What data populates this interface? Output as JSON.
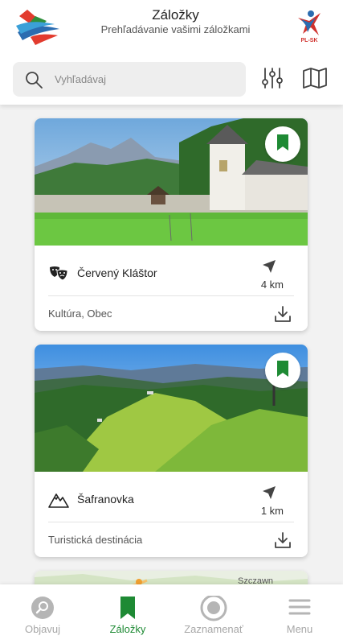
{
  "header": {
    "title": "Záložky",
    "subtitle": "Prehľadávanie vašimi záložkami",
    "partner_logo_text": "PL-SK"
  },
  "search": {
    "placeholder": "Vyhľadávaj",
    "value": ""
  },
  "toolbar": {
    "filter_icon": "sliders-icon",
    "map_icon": "map-icon"
  },
  "cards": [
    {
      "name": "Červený Kláštor",
      "category_icon": "theater-masks-icon",
      "distance": "4 km",
      "tags": "Kultúra, Obec",
      "bookmarked": true
    },
    {
      "name": "Šafranovka",
      "category_icon": "mountain-icon",
      "distance": "1 km",
      "tags": "Turistická destinácia",
      "bookmarked": true
    },
    {
      "map_label": "Szczawn"
    }
  ],
  "tabbar": {
    "tabs": [
      {
        "label": "Objavuj",
        "icon": "search-magnifier-icon",
        "active": false
      },
      {
        "label": "Záložky",
        "icon": "bookmark-icon",
        "active": true
      },
      {
        "label": "Zaznamenať",
        "icon": "record-icon",
        "active": false
      },
      {
        "label": "Menu",
        "icon": "hamburger-icon",
        "active": false
      }
    ]
  },
  "colors": {
    "accent": "#1e8a34",
    "inactive": "#a7a7a7",
    "background": "#f2f2f2"
  }
}
